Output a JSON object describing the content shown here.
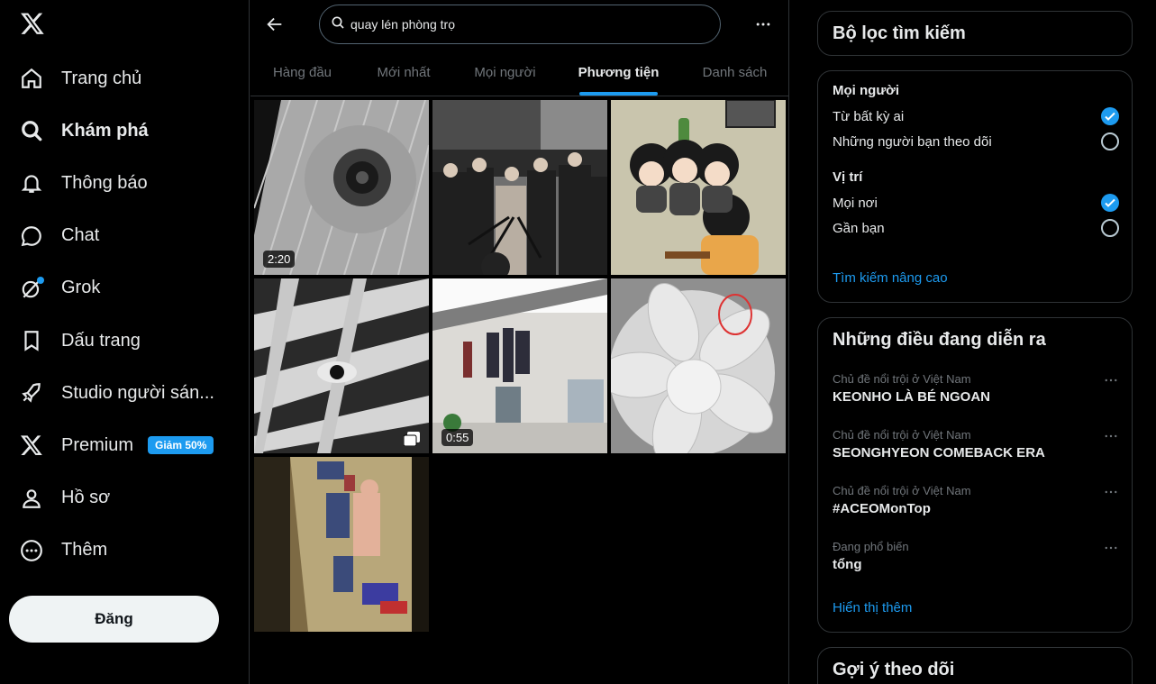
{
  "nav": {
    "items": [
      {
        "label": "Trang chủ"
      },
      {
        "label": "Khám phá"
      },
      {
        "label": "Thông báo"
      },
      {
        "label": "Chat"
      },
      {
        "label": "Grok"
      },
      {
        "label": "Dấu trang"
      },
      {
        "label": "Studio người sán..."
      },
      {
        "label": "Premium",
        "badge": "Giảm 50%"
      },
      {
        "label": "Hồ sơ"
      },
      {
        "label": "Thêm"
      }
    ],
    "post_label": "Đăng"
  },
  "search": {
    "value": "quay lén phòng trọ"
  },
  "tabs": [
    {
      "label": "Hàng đầu"
    },
    {
      "label": "Mới nhất"
    },
    {
      "label": "Mọi người"
    },
    {
      "label": "Phương tiện"
    },
    {
      "label": "Danh sách"
    }
  ],
  "media": [
    {
      "caption": "2:20",
      "type": "video"
    },
    {
      "type": "photo"
    },
    {
      "type": "photo"
    },
    {
      "type": "photo-gallery"
    },
    {
      "caption": "0:55",
      "type": "video"
    },
    {
      "type": "photo"
    },
    {
      "type": "photo"
    }
  ],
  "filters": {
    "title": "Bộ lọc tìm kiếm",
    "people_label": "Mọi người",
    "people_options": [
      {
        "label": "Từ bất kỳ ai",
        "checked": true
      },
      {
        "label": "Những người bạn theo dõi",
        "checked": false
      }
    ],
    "location_label": "Vị trí",
    "location_options": [
      {
        "label": "Mọi nơi",
        "checked": true
      },
      {
        "label": "Gần bạn",
        "checked": false
      }
    ],
    "advanced_link": "Tìm kiếm nâng cao"
  },
  "trends": {
    "title": "Những điều đang diễn ra",
    "items": [
      {
        "context": "Chủ đề nổi trội ở Việt Nam",
        "name": "KEONHO LÀ BÉ NGOAN"
      },
      {
        "context": "Chủ đề nổi trội ở Việt Nam",
        "name": "SEONGHYEON COMEBACK ERA"
      },
      {
        "context": "Chủ đề nổi trội ở Việt Nam",
        "name": "#ACEOMonTop"
      },
      {
        "context": "Đang phổ biến",
        "name": "tổng"
      }
    ],
    "show_more": "Hiển thị thêm"
  },
  "suggest": {
    "title": "Gợi ý theo dõi"
  },
  "colors": {
    "accent": "#1d9bf0",
    "background": "#000000",
    "border": "#2f3336",
    "muted": "#71767b"
  }
}
